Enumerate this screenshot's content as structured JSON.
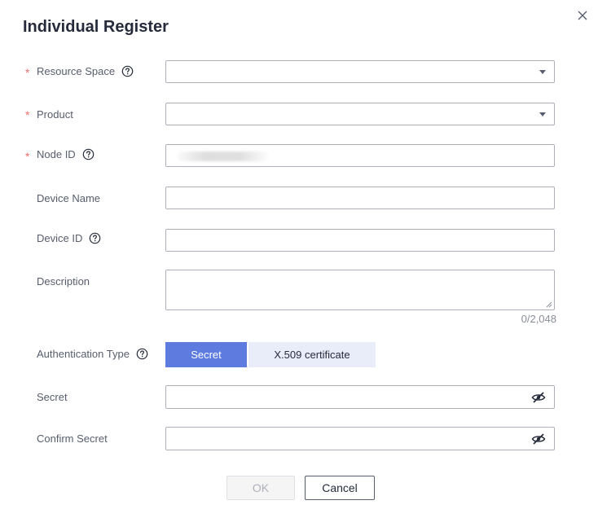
{
  "dialog": {
    "title": "Individual Register"
  },
  "fields": {
    "resource_space": {
      "label": "Resource Space",
      "required_mark": "*"
    },
    "product": {
      "label": "Product",
      "required_mark": "*"
    },
    "node_id": {
      "label": "Node ID",
      "required_mark": "*"
    },
    "device_name": {
      "label": "Device Name"
    },
    "device_id": {
      "label": "Device ID"
    },
    "description": {
      "label": "Description",
      "counter": "0/2,048"
    },
    "auth_type": {
      "label": "Authentication Type",
      "options": [
        "Secret",
        "X.509 certificate"
      ],
      "selected": "Secret"
    },
    "secret": {
      "label": "Secret"
    },
    "confirm_secret": {
      "label": "Confirm Secret"
    }
  },
  "footer": {
    "ok_label": "OK",
    "cancel_label": "Cancel"
  },
  "icons": {
    "help": "question-circle-icon",
    "close": "close-icon",
    "dropdown": "chevron-down-icon",
    "visibility": "eye-off-icon"
  },
  "colors": {
    "primary": "#5e7ce0",
    "required": "#f66f6a",
    "segment_inactive": "#e9edfa",
    "border": "#adb0b8"
  }
}
